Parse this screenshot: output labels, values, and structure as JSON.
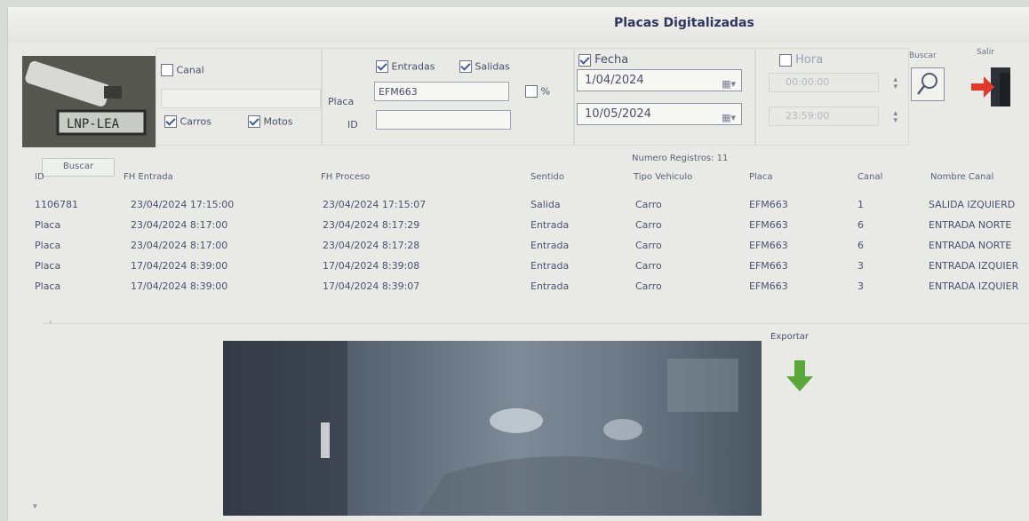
{
  "window": {
    "title": "Placas Digitalizadas"
  },
  "filters": {
    "canal": {
      "label": "Canal",
      "checked": false
    },
    "carros": {
      "label": "Carros",
      "checked": true
    },
    "motos": {
      "label": "Motos",
      "checked": true
    },
    "entradas": {
      "label": "Entradas",
      "checked": true
    },
    "salidas": {
      "label": "Salidas",
      "checked": true
    },
    "placa_label": "Placa",
    "placa_value": "EFM663",
    "percent_label": "%",
    "percent_checked": false,
    "id_label": "ID",
    "id_value": "",
    "fecha": {
      "label": "Fecha",
      "checked": true,
      "from": "1/04/2024",
      "to": "10/05/2024"
    },
    "hora": {
      "label": "Hora",
      "checked": false,
      "from": "00:00:00",
      "to": "23:59:00"
    }
  },
  "actions": {
    "buscar_label": "Buscar",
    "salir_label": "Salir",
    "exportar_label": "Exportar"
  },
  "tab": {
    "buscar_label": "Buscar"
  },
  "summary": {
    "records": "Numero Registros: 11"
  },
  "table": {
    "columns": [
      "ID",
      "FH Entrada",
      "FH Proceso",
      "Sentido",
      "Tipo Vehiculo",
      "Placa",
      "Canal",
      "Nombre Canal"
    ],
    "rows": [
      [
        "1106781",
        "23/04/2024 17:15:00",
        "23/04/2024 17:15:07",
        "Salida",
        "Carro",
        "EFM663",
        "1",
        "SALIDA IZQUIERD"
      ],
      [
        "Placa",
        "23/04/2024 8:17:00",
        "23/04/2024 8:17:29",
        "Entrada",
        "Carro",
        "EFM663",
        "6",
        "ENTRADA NORTE"
      ],
      [
        "Placa",
        "23/04/2024 8:17:00",
        "23/04/2024 8:17:28",
        "Entrada",
        "Carro",
        "EFM663",
        "6",
        "ENTRADA NORTE"
      ],
      [
        "Placa",
        "17/04/2024 8:39:00",
        "17/04/2024 8:39:08",
        "Entrada",
        "Carro",
        "EFM663",
        "3",
        "ENTRADA IZQUIER"
      ],
      [
        "Placa",
        "17/04/2024 8:39:00",
        "17/04/2024 8:39:07",
        "Entrada",
        "Carro",
        "EFM663",
        "3",
        "ENTRADA IZQUIER"
      ]
    ]
  },
  "colors": {
    "accent": "#3d5fa1",
    "title": "#2d3561",
    "export_arrow": "#5aa83a",
    "exit_arrow": "#e23a2a"
  },
  "icons": {
    "search": "magnifier-icon",
    "exit": "exit-door-icon",
    "export": "down-arrow-icon",
    "logo": "lpr-camera-logo"
  }
}
